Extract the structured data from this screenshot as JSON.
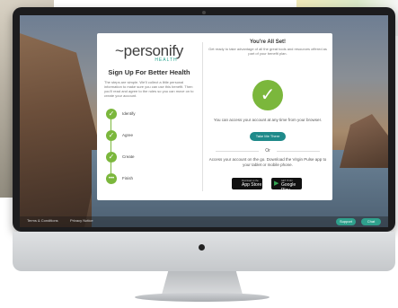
{
  "left_panel": {
    "logo_text": "~personify",
    "logo_sub": "HEALTH",
    "title": "Sign Up For Better Health",
    "description": "The steps are simple. We'll collect a little personal information to make sure you can use this benefit. Then you'll read and agree to the rules so you can move on to create your account.",
    "steps": [
      {
        "label": "Identify",
        "icon": "check-icon"
      },
      {
        "label": "Agree",
        "icon": "check-icon"
      },
      {
        "label": "Create",
        "icon": "check-icon"
      },
      {
        "label": "Finish",
        "icon": "dots-icon"
      }
    ]
  },
  "right_panel": {
    "title": "You're All Set!",
    "description": "Get ready to take advantage of all the great tools and resources offered as part of your benefit plan.",
    "access_text": "You can access your account at any time from your browser.",
    "button_label": "Take Me There",
    "or_label": "Or",
    "mobile_text": "Access your account on the go. Download the Virgin Pulse app to your tablet or mobile phone.",
    "app_store": {
      "small": "Download on the",
      "name": "App Store"
    },
    "google_play": {
      "small": "GET IT ON",
      "name": "Google Play"
    }
  },
  "footer": {
    "left_text": "Terms & Conditions",
    "left_text_2": "Privacy Notice",
    "support_label": "Support",
    "chat_label": "Chat"
  },
  "colors": {
    "accent_green": "#7bb73c",
    "button_teal": "#1f8a8a",
    "health_teal": "#2aa58f"
  }
}
